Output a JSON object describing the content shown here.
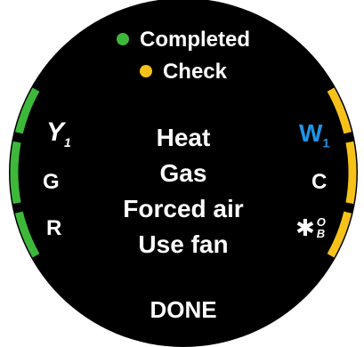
{
  "legend": {
    "completed": {
      "label": "Completed",
      "color": "#3db83a"
    },
    "check": {
      "label": "Check",
      "color": "#f6c21a"
    }
  },
  "summary": {
    "lines": [
      "Heat",
      "Gas",
      "Forced air",
      "Use fan"
    ]
  },
  "terminals": {
    "left": [
      {
        "letter": "Y",
        "sub": "1",
        "status": "completed",
        "color": "#ffffff"
      },
      {
        "letter": "G",
        "sub": "",
        "status": "completed",
        "color": "#ffffff"
      },
      {
        "letter": "R",
        "sub": "",
        "status": "completed",
        "color": "#ffffff"
      }
    ],
    "right": [
      {
        "letter": "W",
        "sub": "1",
        "status": "check",
        "color": "#1f95e6"
      },
      {
        "letter": "C",
        "sub": "",
        "status": "check",
        "color": "#ffffff"
      },
      {
        "letter": "✱",
        "sup": "O",
        "sub": "B",
        "status": "check",
        "color": "#ffffff"
      }
    ]
  },
  "done_label": "DONE"
}
